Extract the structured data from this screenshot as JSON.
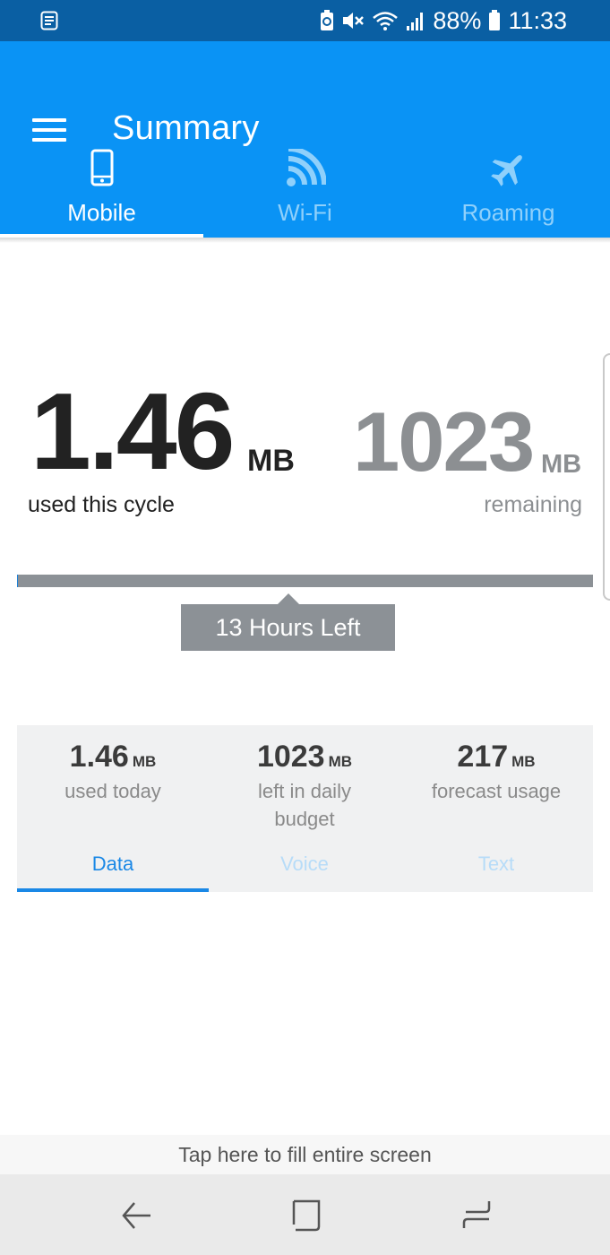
{
  "status_bar": {
    "battery": "88%",
    "time": "11:33",
    "icons": [
      "notes-icon",
      "data-saver-icon",
      "mute-icon",
      "wifi-icon",
      "signal-icon",
      "battery-icon"
    ]
  },
  "app_bar": {
    "title": "Summary",
    "tabs": [
      {
        "label": "Mobile",
        "icon": "phone-icon",
        "active": true
      },
      {
        "label": "Wi-Fi",
        "icon": "wifi-icon",
        "active": false
      },
      {
        "label": "Roaming",
        "icon": "airplane-icon",
        "active": false
      }
    ]
  },
  "cycle": {
    "used_value": "1.46",
    "used_unit": "MB",
    "used_label": "used this cycle",
    "remaining_value": "1023",
    "remaining_unit": "MB",
    "remaining_label": "remaining",
    "used_fraction": 0.0014,
    "time_left": "13 Hours Left"
  },
  "daily": {
    "stats": [
      {
        "value": "1.46",
        "unit": "MB",
        "label": "used today"
      },
      {
        "value": "1023",
        "unit": "MB",
        "label": "left in daily budget"
      },
      {
        "value": "217",
        "unit": "MB",
        "label": "forecast usage"
      }
    ],
    "tabs": [
      {
        "label": "Data",
        "active": true
      },
      {
        "label": "Voice",
        "active": false
      },
      {
        "label": "Text",
        "active": false
      }
    ]
  },
  "footer": {
    "fill_screen": "Tap here to fill entire screen"
  },
  "colors": {
    "status_bar": "#0a5fa3",
    "app_bar": "#0a93f5",
    "accent": "#1a88e6",
    "muted_gray": "#8c9196"
  }
}
